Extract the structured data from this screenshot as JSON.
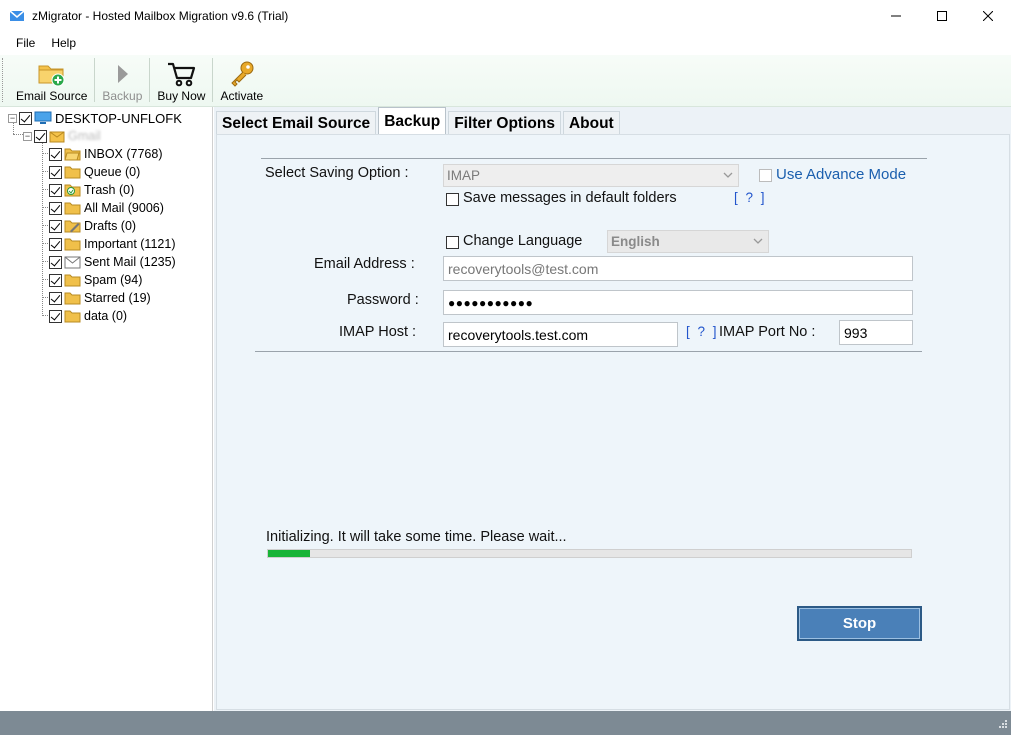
{
  "window": {
    "title": "zMigrator - Hosted Mailbox Migration v9.6 (Trial)"
  },
  "menu": [
    "File",
    "Help"
  ],
  "toolbar": {
    "email_source": "Email Source",
    "backup": "Backup",
    "buy_now": "Buy Now",
    "activate": "Activate"
  },
  "tree": {
    "root": "DESKTOP-UNFLOFK",
    "account": "Gmail",
    "folders": [
      "INBOX (7768)",
      "Queue (0)",
      "Trash (0)",
      "All Mail (9006)",
      "Drafts (0)",
      "Important (1121)",
      "Sent Mail (1235)",
      "Spam (94)",
      "Starred (19)",
      "data (0)"
    ]
  },
  "tabs": [
    "Select Email Source",
    "Backup",
    "Filter Options",
    "About"
  ],
  "active_tab": "Backup",
  "form": {
    "saving_option_label": "Select Saving Option :",
    "saving_option_value": "IMAP",
    "advance_mode": "Use Advance Mode",
    "save_default_folders": "Save messages in default folders",
    "help": "[ ? ]",
    "change_language": "Change Language",
    "language_value": "English",
    "email_label": "Email Address :",
    "email_value": "recoverytools@test.com",
    "password_label": "Password :",
    "password_value": "●●●●●●●●●●●",
    "imap_host_label": "IMAP Host :",
    "imap_host_value": "recoverytools.test.com",
    "imap_port_label": "IMAP Port No :",
    "imap_port_value": "993"
  },
  "progress": {
    "status_text": "Initializing. It will take some time. Please wait...",
    "percent": 6.5
  },
  "stop_button": "Stop",
  "colors": {
    "progress_fill": "#17b437",
    "stop_button": "#4a80b8",
    "link": "#1b5fae",
    "statusbar": "#7d8a94"
  }
}
